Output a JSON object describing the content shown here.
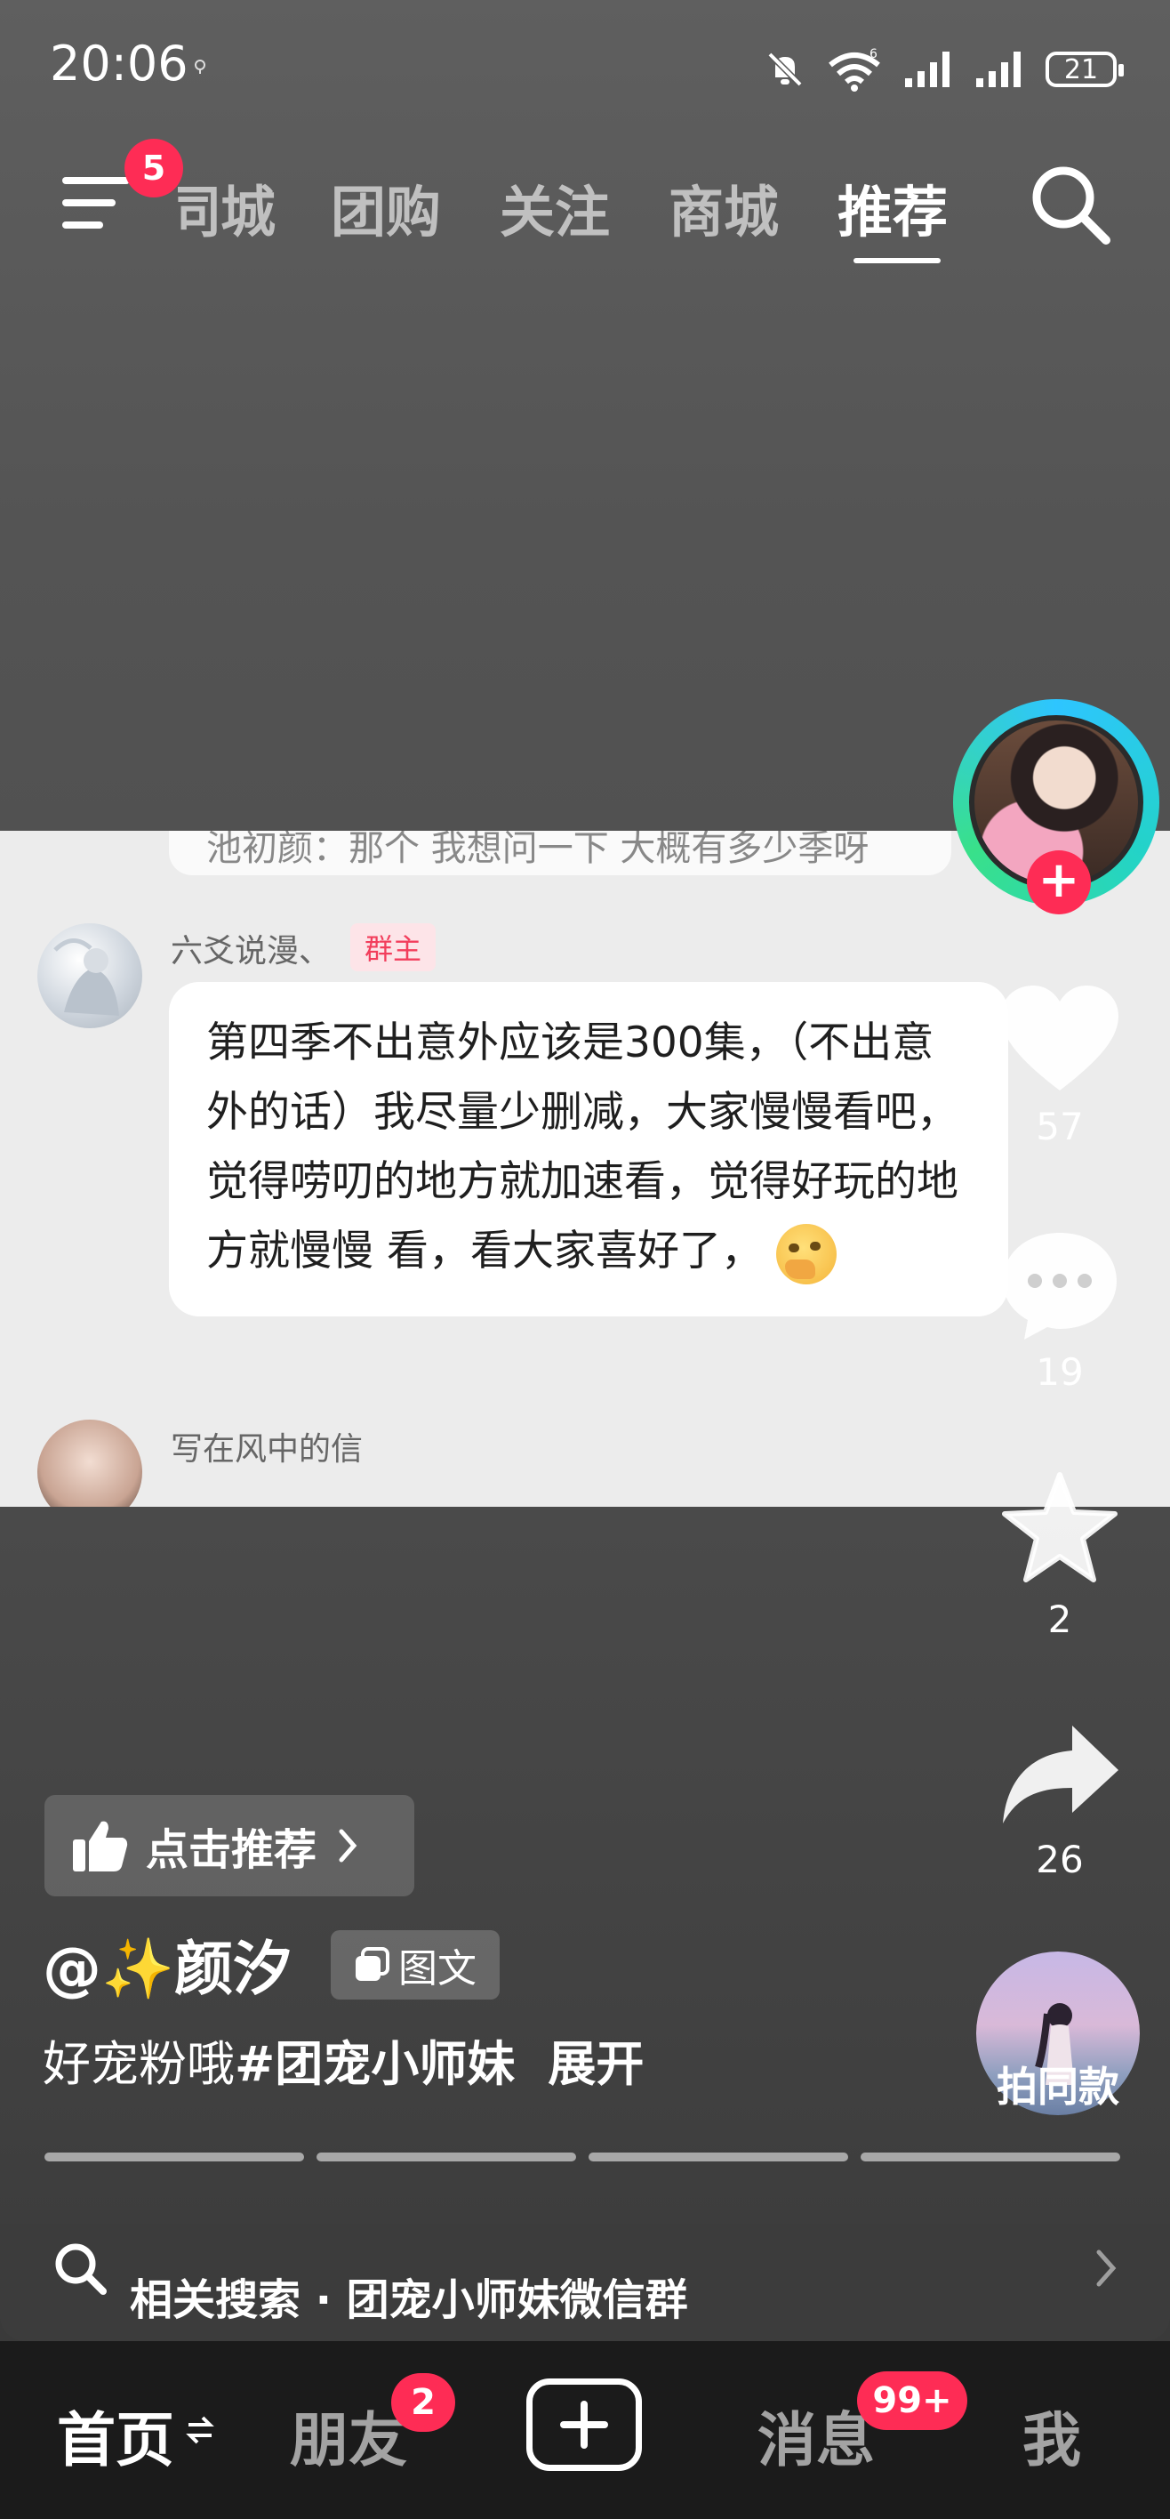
{
  "status_bar": {
    "time": "20:06",
    "icons": [
      "notification-dot-icon",
      "mute-bell-icon",
      "wifi-icon",
      "signal-icon",
      "signal-icon",
      "battery-icon"
    ],
    "battery": "21"
  },
  "top_nav": {
    "menu_badge": "5",
    "tabs": [
      {
        "label": "同城",
        "active": false
      },
      {
        "label": "团购",
        "active": false
      },
      {
        "label": "关注",
        "active": false
      },
      {
        "label": "商城",
        "active": false
      },
      {
        "label": "推荐",
        "active": true
      }
    ]
  },
  "post_image": {
    "prev_comment": "池初颜：那个 我想问一下 大概有多少季呀",
    "comment": {
      "name": "六爻说漫、",
      "tag": "群主",
      "text": "第四季不出意外应该是300集，（不出意外的话）我尽量少删减，大家慢慢看吧，觉得唠叨的地方就加速看，觉得好玩的地方就慢慢 看，看大家喜好了，"
    },
    "next_name": "写在风中的信"
  },
  "actions": {
    "likes": "57",
    "comments": "19",
    "favorites": "2",
    "shares": "26",
    "same_style": "拍同款"
  },
  "caption": {
    "recommend": "点击推荐",
    "author": "@✨颜汐",
    "type_tag": "图文",
    "text": "好宠粉哦",
    "hashtag": "#团宠小师妹",
    "expand": "展开"
  },
  "progress": {
    "segments": 4
  },
  "related_search": {
    "text": "相关搜索 · 团宠小师妹微信群"
  },
  "bottom_nav": {
    "home": "首页",
    "friends": "朋友",
    "friends_badge": "2",
    "messages": "消息",
    "messages_badge": "99+",
    "me": "我"
  },
  "colors": {
    "accent": "#fe2c55",
    "ring": "#2ec5ff"
  }
}
